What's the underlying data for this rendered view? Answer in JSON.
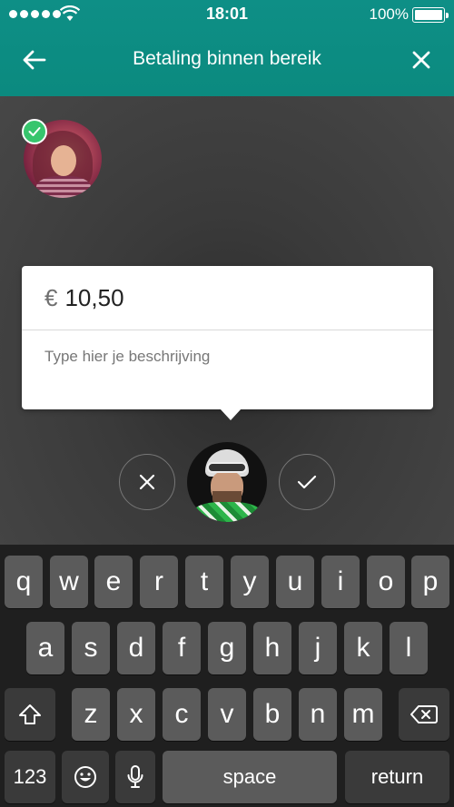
{
  "status_bar": {
    "time": "18:01",
    "battery_percent": "100%",
    "battery_level": 1.0,
    "signal_bars": 5
  },
  "nav": {
    "title": "Betaling binnen bereik",
    "back_icon": "arrow-left-icon",
    "close_icon": "close-icon"
  },
  "payment": {
    "currency_symbol": "€",
    "amount": "10,50",
    "description_placeholder": "Type hier je beschrijving"
  },
  "actions": {
    "cancel_icon": "close-icon",
    "confirm_icon": "checkmark-icon"
  },
  "keyboard": {
    "row1": [
      "q",
      "w",
      "e",
      "r",
      "t",
      "y",
      "u",
      "i",
      "o",
      "p"
    ],
    "row2": [
      "a",
      "s",
      "d",
      "f",
      "g",
      "h",
      "j",
      "k",
      "l"
    ],
    "row3": [
      "z",
      "x",
      "c",
      "v",
      "b",
      "n",
      "m"
    ],
    "numbers_key": "123",
    "space_key": "space",
    "return_key": "return"
  },
  "colors": {
    "header": "#0e8f86",
    "check_badge": "#37c56d"
  }
}
